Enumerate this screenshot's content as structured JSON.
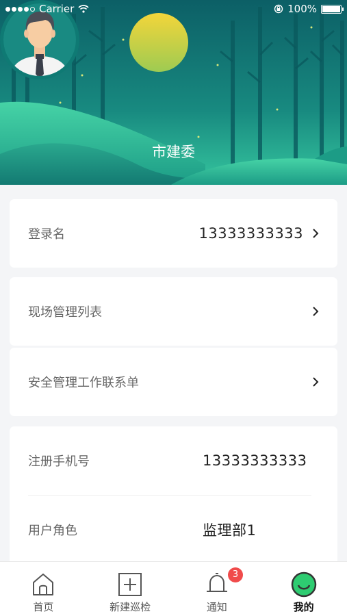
{
  "status_bar": {
    "carrier": "Carrier",
    "battery": "100%"
  },
  "profile": {
    "name": "市建委"
  },
  "rows": {
    "login": {
      "label": "登录名",
      "value": "13333333333"
    },
    "site_list": {
      "label": "现场管理列表"
    },
    "safety_sheet": {
      "label": "安全管理工作联系单"
    },
    "phone": {
      "label": "注册手机号",
      "value": "13333333333"
    },
    "role": {
      "label": "用户角色",
      "value": "监理部1"
    }
  },
  "tabbar": {
    "items": [
      {
        "label": "首页",
        "icon": "home-icon"
      },
      {
        "label": "新建巡检",
        "icon": "plus-square-icon"
      },
      {
        "label": "通知",
        "icon": "bell-icon",
        "badge": "3"
      },
      {
        "label": "我的",
        "icon": "smile-icon",
        "active": true
      }
    ]
  },
  "colors": {
    "header_dark": "#0e6e6a",
    "header_light": "#2dbf95",
    "accent": "#2ecc71",
    "badge": "#f04b4b"
  }
}
